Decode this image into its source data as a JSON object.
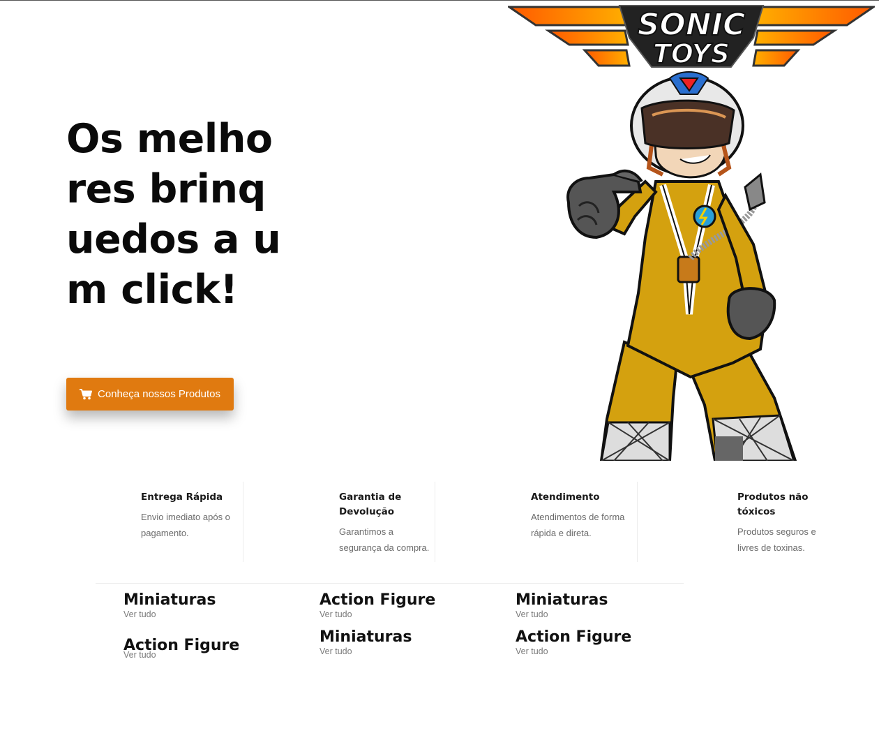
{
  "brand": {
    "logo_text": "SONIC TOYS",
    "accent": "#e07a10"
  },
  "hero": {
    "title": "Os melhores brinquedos a um click!",
    "cta_label": "Conheça nossos Produtos",
    "cta_icon": "cart-icon"
  },
  "features": [
    {
      "title": "Entrega Rápida",
      "desc": "Envio imediato após o pagamento."
    },
    {
      "title": "Garantia de Devolução",
      "desc": "Garantimos a segurança da compra."
    },
    {
      "title": "Atendimento",
      "desc": "Atendimentos de forma rápida e direta."
    },
    {
      "title": "Produtos não tóxicos",
      "desc": "Produtos seguros e livres de toxinas."
    }
  ],
  "categories": [
    {
      "title": "Miniaturas",
      "link": "Ver tudo"
    },
    {
      "title": "Action Figure",
      "link": "Ver tudo"
    },
    {
      "title": "Miniaturas",
      "link": "Ver tudo"
    },
    {
      "title": "Action Figure",
      "link": "Ver tudo"
    },
    {
      "title": "Miniaturas",
      "link": "Ver tudo"
    },
    {
      "title": "Action Figure",
      "link": "Ver tudo"
    }
  ]
}
